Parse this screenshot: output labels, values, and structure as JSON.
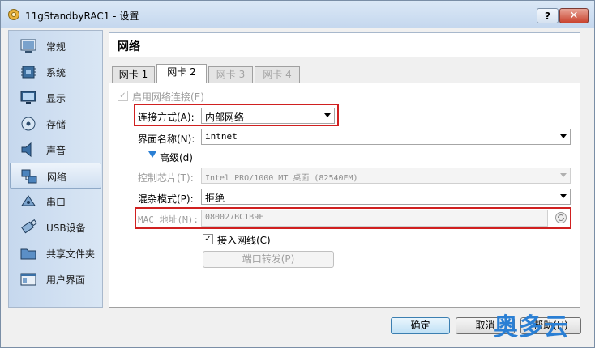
{
  "window": {
    "title": "11gStandbyRAC1 - 设置"
  },
  "sidebar": {
    "items": [
      {
        "label": "常规",
        "icon": "general-icon"
      },
      {
        "label": "系统",
        "icon": "system-chip-icon"
      },
      {
        "label": "显示",
        "icon": "monitor-icon"
      },
      {
        "label": "存储",
        "icon": "storage-disk-icon"
      },
      {
        "label": "声音",
        "icon": "speaker-icon"
      },
      {
        "label": "网络",
        "icon": "network-icon",
        "selected": true
      },
      {
        "label": "串口",
        "icon": "serial-port-icon"
      },
      {
        "label": "USB设备",
        "icon": "usb-icon"
      },
      {
        "label": "共享文件夹",
        "icon": "shared-folder-icon"
      },
      {
        "label": "用户界面",
        "icon": "user-interface-icon"
      }
    ]
  },
  "header": {
    "title": "网络"
  },
  "tabs": [
    {
      "label": "网卡 1",
      "state": "normal"
    },
    {
      "label": "网卡 2",
      "state": "active"
    },
    {
      "label": "网卡 3",
      "state": "disabled"
    },
    {
      "label": "网卡 4",
      "state": "disabled"
    }
  ],
  "form": {
    "enable_label": "启用网络连接(E)",
    "enable_checked": true,
    "attach_label": "连接方式(A):",
    "attach_value": "内部网络",
    "name_label": "界面名称(N):",
    "name_value": "intnet",
    "advanced_label": "高级(d)",
    "adapter_label": "控制芯片(T):",
    "adapter_value": "Intel PRO/1000 MT 桌面 (82540EM)",
    "promisc_label": "混杂模式(P):",
    "promisc_value": "拒绝",
    "mac_label": "MAC 地址(M):",
    "mac_value": "080027BC1B9F",
    "cable_label": "接入网线(C)",
    "cable_checked": true,
    "port_forward_label": "端口转发(P)"
  },
  "buttons": {
    "ok": "确定",
    "cancel": "取消",
    "help": "帮助(H)"
  },
  "titlebar_buttons": {
    "help": "?",
    "close": "✕"
  },
  "watermark": "奥多云",
  "colors": {
    "highlight_red": "#d02020",
    "sidebar_bg": "#c6d8ee",
    "watermark_blue": "#2a7fd4"
  }
}
